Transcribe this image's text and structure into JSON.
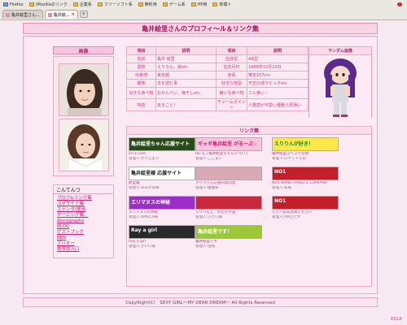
{
  "browser": {
    "bookmarks": [
      {
        "label": "Firefox",
        "icon": "firefox-icon"
      },
      {
        "label": "(Mozillaのリンク",
        "icon": "folder-icon"
      },
      {
        "label": "企業系",
        "icon": "folder-icon"
      },
      {
        "label": "フリーソフト系",
        "icon": "folder-icon"
      },
      {
        "label": "無料用",
        "icon": "folder-icon"
      },
      {
        "label": "ゲーム系",
        "icon": "folder-icon"
      },
      {
        "label": "HP用",
        "icon": "folder-icon"
      },
      {
        "label": "新聞ト",
        "icon": "folder-icon"
      }
    ],
    "tabs": [
      {
        "label": "亀井絵里さん...",
        "active": false
      },
      {
        "label": "亀井絵...",
        "active": true
      }
    ]
  },
  "page": {
    "title": "亀井絵里さんのプロフィ～ル＆リンク集",
    "sidebar_photo_head": "画像",
    "menu_head": "こんてんつ",
    "menu_items": [
      "プロフ&リンク集",
      "ぷぜサイト集",
      "ステンダ(間用",
      "キーニング集。",
      "discographs",
      "BLOG",
      "ゲストブック",
      "BBS",
      "アバター",
      "携帯版入口"
    ],
    "footer": "CopyRight(C)　SEXY GIRL～MY DEAR DREAM～ All Rights Reserved",
    "corner": "ESLB"
  },
  "profile": {
    "headers": [
      "項目",
      "説明",
      "項目",
      "説明"
    ],
    "rows": [
      [
        "名前",
        "亀井 絵里",
        "血液型",
        "AB型"
      ],
      [
        "愛称",
        "えりりん、絵etc.",
        "生年月日",
        "1988年12月23日"
      ],
      [
        "出身地",
        "東京都",
        "身長",
        "推定157cm"
      ],
      [
        "趣味",
        "本を読む事",
        "好きな物語",
        "天空の城ラピュタetc."
      ],
      [
        "好きな食べ物",
        "おせんべい、梅干しetc.",
        "嫌いな食べ物",
        "ミル食い・"
      ],
      [
        "特技",
        "走ること！",
        "チャームポイント",
        "八重歯が可愛い優雅人見柄い"
      ]
    ],
    "rank_head": "ランダム画像"
  },
  "links": {
    "head": "リンク集",
    "items": [
      {
        "banner": "亀井絵里ちゃん応援サイト",
        "banner_color": "#2a4a1a",
        "text_color": "#ffffff",
        "caption": "eri-k.com",
        "sub": "管理人:かりじまり"
      },
      {
        "banner": "ギャギ亀井絵里 がるーぷ☆",
        "banner_color": "#f7c5dd",
        "text_color": "#d81b7a",
        "caption": "Re:モフ亀井絵里ちゃんについて",
        "sub": "管理人:ここまい"
      },
      {
        "banner": "えりりんが好き！",
        "banner_color": "#ffe94a",
        "text_color": "#1a8a1a",
        "caption": "亀井絵里ぷりぷり空間",
        "sub": "管理人:ロナットら前"
      },
      {
        "banner": "亀井絵里様 応援サイト",
        "banner_color": "#ffffff",
        "text_color": "#222222",
        "caption": "絵里亀",
        "sub": "管理人:みみかお様"
      },
      {
        "banner": "",
        "banner_color": "#d9a9b5",
        "text_color": "#ffffff",
        "caption": "きりりりん応援同盟同盟",
        "sub": "管理人:優雅様"
      },
      {
        "banner": "NO1",
        "banner_color": "#c21f2a",
        "text_color": "#ffffff",
        "caption": "NO1 KAMEI FANSITE COMPANY",
        "sub": "管理人:家様"
      },
      {
        "banner": "エリマヌスの神秘",
        "banner_color": "#9b2ec9",
        "text_color": "#ffffff",
        "caption": "エリマヌスの神秘",
        "sub": "管理人:AMDCA様"
      },
      {
        "banner": "",
        "banner_color": "#c9283a",
        "text_color": "#ffffff",
        "caption": "えりりんと、何だか宇宙",
        "sub": "管理人:ひさい様"
      },
      {
        "banner": "NO1",
        "banner_color": "#c21f2a",
        "text_color": "#ffffff",
        "caption": "ええー是非お来ください",
        "sub": "管理人:PMさげす"
      },
      {
        "banner": "Ray a girl",
        "banner_color": "#2a2a2a",
        "text_color": "#ffffff",
        "caption": "Ray a girl",
        "sub": "管理人:さいい様"
      },
      {
        "banner": "亀井絵里です！",
        "banner_color": "#9ac838",
        "text_color": "#ffffff",
        "caption": "亀井絵里です",
        "sub": "管理人:蛍様"
      }
    ]
  }
}
